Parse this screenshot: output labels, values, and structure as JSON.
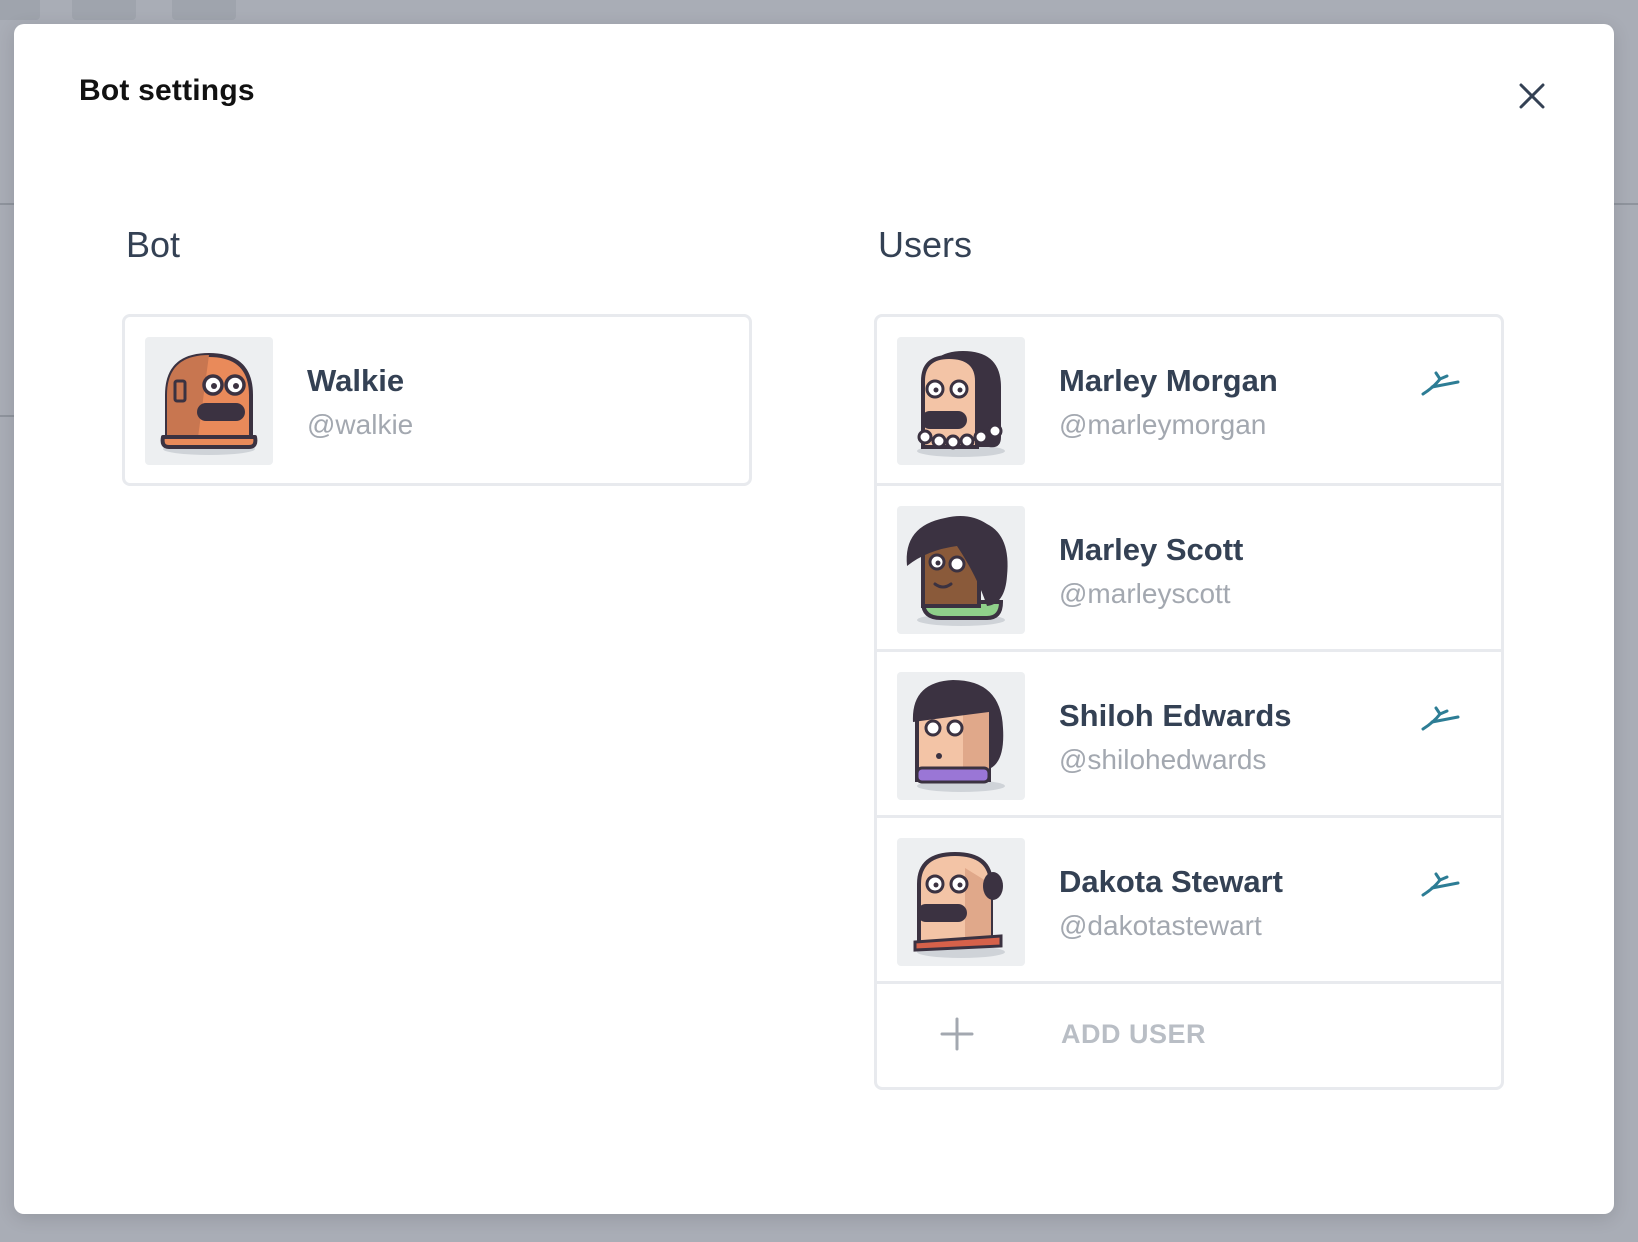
{
  "modal": {
    "title": "Bot settings",
    "close_icon": "close-icon"
  },
  "bot_section": {
    "heading": "Bot",
    "bot": {
      "name": "Walkie",
      "handle": "@walkie",
      "avatar_icon": "robot-avatar"
    }
  },
  "users_section": {
    "heading": "Users",
    "users": [
      {
        "name": "Marley Morgan",
        "handle": "@marleymorgan",
        "admin": true
      },
      {
        "name": "Marley Scott",
        "handle": "@marleyscott",
        "admin": false
      },
      {
        "name": "Shiloh Edwards",
        "handle": "@shilohedwards",
        "admin": true
      },
      {
        "name": "Dakota Stewart",
        "handle": "@dakotastewart",
        "admin": true
      }
    ],
    "admin_icon": "admin-badge-icon",
    "add_user_label": "ADD USER",
    "add_icon": "plus-icon"
  },
  "colors": {
    "accent": "#2d7d95",
    "text_dark": "#344154",
    "text_muted": "#a3a8b0",
    "border": "#e8eaee",
    "overlay": "#a9adb6"
  }
}
